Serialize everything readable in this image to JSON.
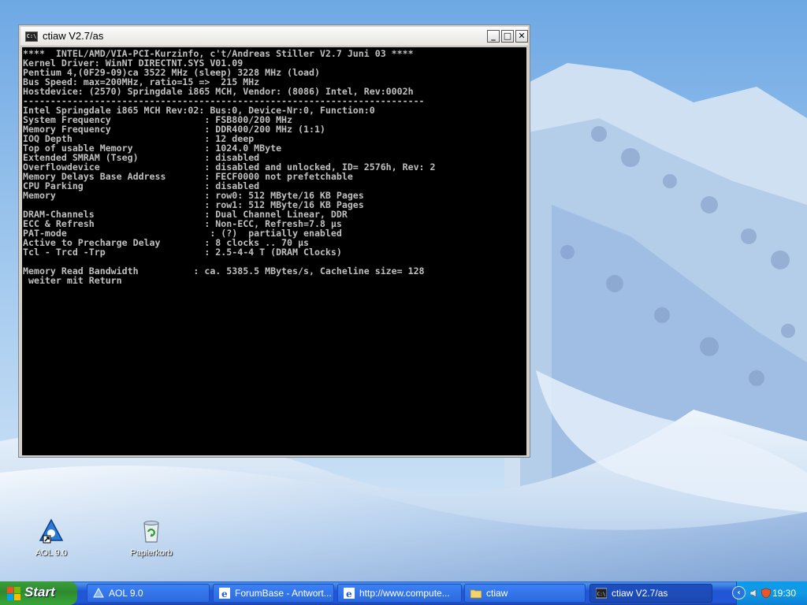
{
  "window": {
    "title": "ctiaw V2.7/as",
    "buttons": {
      "minimize": "_",
      "maximize": "□",
      "close": "✕"
    }
  },
  "console": {
    "lines": [
      "****  INTEL/AMD/VIA-PCI-Kurzinfo, c't/Andreas Stiller V2.7 Juni 03 ****",
      "Kernel Driver: WinNT DIRECTNT.SYS V01.09",
      "Pentium 4,(0F29-09)ca 3522 MHz (sleep) 3228 MHz (load)",
      "Bus Speed: max=200MHz, ratio=15 =>  215 MHz",
      "Hostdevice: (2570) Springdale i865 MCH, Vendor: (8086) Intel, Rev:0002h",
      "-------------------------------------------------------------------------",
      "Intel Springdale i865 MCH Rev:02: Bus:0, Device-Nr:0, Function:0",
      "System Frequency                 : FSB800/200 MHz",
      "Memory Frequency                 : DDR400/200 MHz (1:1)",
      "IOQ Depth                        : 12 deep",
      "Top of usable Memory             : 1024.0 MByte",
      "Extended SMRAM (Tseg)            : disabled",
      "Overflowdevice                   : disabled and unlocked, ID= 2576h, Rev: 2",
      "Memory Delays Base Address       : FECF0000 not prefetchable",
      "CPU Parking                      : disabled",
      "Memory                           : row0: 512 MByte/16 KB Pages",
      "                                 : row1: 512 MByte/16 KB Pages",
      "DRAM-Channels                    : Dual Channel Linear, DDR",
      "ECC & Refresh                    : Non-ECC, Refresh=7.8 µs",
      "PAT-mode                          : (?)  partially enabled",
      "Active to Precharge Delay        : 8 clocks .. 70 µs",
      "Tcl - Trcd -Trp                  : 2.5-4-4 T (DRAM Clocks)",
      "",
      "Memory Read Bandwidth          : ca. 5385.5 MBytes/s, Cacheline size= 128",
      " weiter mit Return"
    ]
  },
  "desktop": {
    "icons": [
      {
        "label": "AOL 9.0",
        "icon": "aol-icon"
      },
      {
        "label": "Papierkorb",
        "icon": "recycle-bin-icon"
      }
    ]
  },
  "taskbar": {
    "start_label": "Start",
    "tasks": [
      {
        "label": "AOL 9.0",
        "icon": "aol-icon",
        "active": false
      },
      {
        "label": "ForumBase - Antwort...",
        "icon": "ie-icon",
        "active": false
      },
      {
        "label": "http://www.compute...",
        "icon": "ie-icon",
        "active": false
      },
      {
        "label": "ctiaw",
        "icon": "folder-icon",
        "active": false
      },
      {
        "label": "ctiaw V2.7/as",
        "icon": "console-icon",
        "active": true
      }
    ],
    "clock": "19:30"
  },
  "colors": {
    "console_bg": "#000000",
    "console_fg": "#c0c0c0",
    "taskbar_blue": "#2157d7",
    "start_green": "#2e8a2e"
  }
}
